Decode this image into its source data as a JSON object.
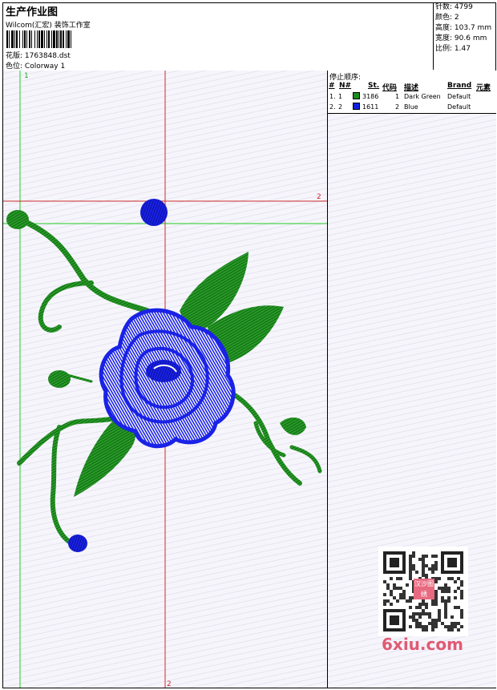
{
  "header": {
    "title": "生产作业图",
    "studio": "Wilcom(汇宏) 装饰工作室",
    "design_file_label": "花版:",
    "design_file": "1763848.dst",
    "colorway_label": "色位:",
    "colorway": "Colorway 1"
  },
  "stats": {
    "stitches_label": "针数:",
    "stitches": "4799",
    "colors_label": "颜色:",
    "colors": "2",
    "height_label": "高度:",
    "height": "103.7 mm",
    "width_label": "宽度:",
    "width": "90.6 mm",
    "ratio_label": "比例:",
    "ratio": "1.47"
  },
  "stop_sequence": {
    "title": "停止顺序:",
    "columns": [
      "#",
      "N#",
      "St.",
      "代码",
      "描述",
      "Brand",
      "元素"
    ],
    "rows": [
      {
        "index": "1.",
        "n": "1",
        "stitches": "3186",
        "code": "1",
        "desc": "Dark Green",
        "brand": "Default",
        "color": "#1e8a1e"
      },
      {
        "index": "2.",
        "n": "2",
        "stitches": "1611",
        "code": "2",
        "desc": "Blue",
        "brand": "Default",
        "color": "#1020e0"
      }
    ]
  },
  "guides": {
    "green_label": "1",
    "red_h_label": "2",
    "red_v_label": "2"
  },
  "watermark": {
    "seal_text": "汉沙图绣",
    "site": "6xiu.com"
  },
  "colors": {
    "green_thread": "#1e8a1e",
    "blue_thread": "#1a22e6",
    "guide_red": "#cc2a2a",
    "guide_green": "#22cc22"
  }
}
